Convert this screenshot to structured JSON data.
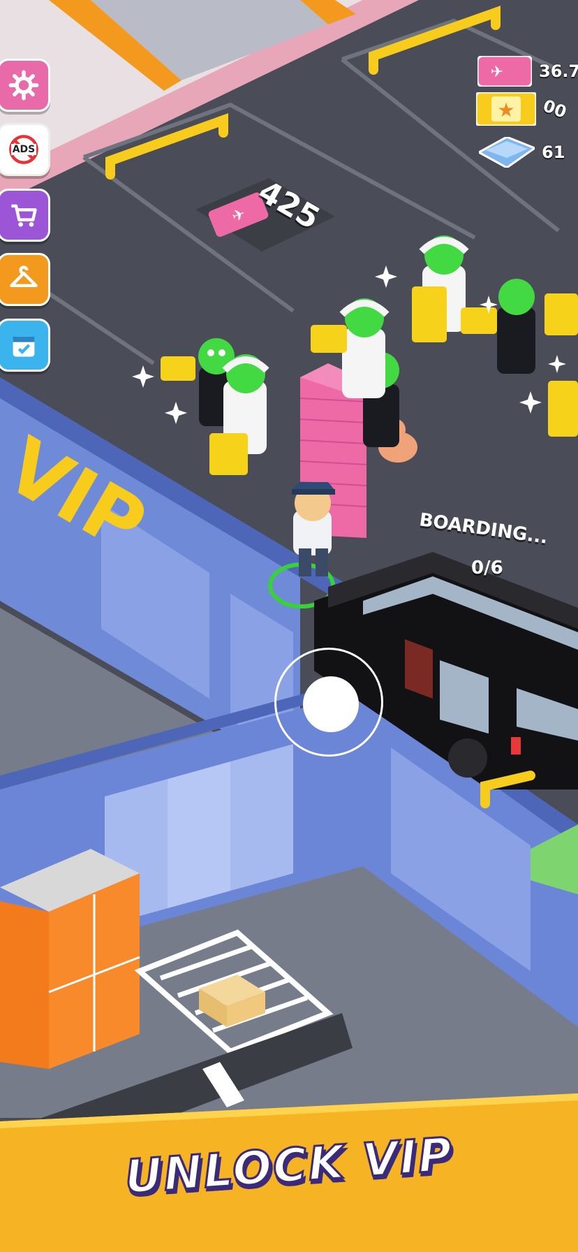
{
  "hud": {
    "resources": [
      {
        "name": "ticket",
        "icon": "plane-ticket-icon",
        "value": "36.7"
      },
      {
        "name": "star",
        "icon": "star-card-icon",
        "value": "00"
      },
      {
        "name": "gem",
        "icon": "blue-gem-icon",
        "value": "61"
      }
    ],
    "side_buttons": [
      {
        "name": "settings",
        "icon": "gear-icon",
        "color": "#e86aa8"
      },
      {
        "name": "no-ads",
        "icon": "no-ads-icon",
        "label": "ADS",
        "color": "#ffffff"
      },
      {
        "name": "shop",
        "icon": "cart-icon",
        "color": "#9b55d6"
      },
      {
        "name": "outfit",
        "icon": "hanger-icon",
        "color": "#f39a1e"
      },
      {
        "name": "calendar",
        "icon": "calendar-icon",
        "color": "#3bb4ee"
      }
    ]
  },
  "world": {
    "parking_counter": "425",
    "vip_sign": "VIP",
    "boarding_label": "BOARDING...",
    "boarding_progress": "0/6"
  },
  "banner": {
    "text": "UNLOCK VIP",
    "color": "#f6b424"
  },
  "colors": {
    "floor": "#4a4d57",
    "wall": "#6b86d6",
    "accent_yellow": "#f7cc1d",
    "ticket_pink": "#ee6aa7"
  }
}
